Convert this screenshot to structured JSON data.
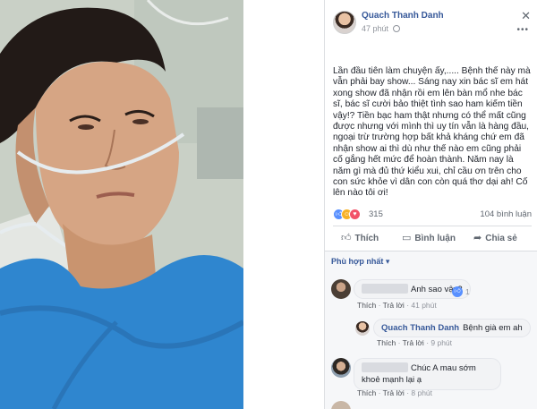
{
  "post": {
    "author": "Quach Thanh Danh",
    "time": "47 phút",
    "text": "Lần đầu tiên làm chuyện ấy,..... Bệnh thế này mà vẫn phải bay show... Sáng nay xin bác sĩ em hát xong show đã nhận rồi em lên bàn mổ nhe bác sĩ, bác sĩ cười bảo thiệt tình sao ham kiếm tiền vậy!? Tiền bạc ham thật nhưng có thể mất cũng được nhưng với mình thì uy tín vẫn là hàng đầu, ngoại trừ trường hợp bất khả kháng chứ em đã nhận show ai thì dù như thế nào em cũng phải cố gắng hết mức để hoàn thành. Năm nay là năm gì mà đủ thứ kiểu xui, chỉ cầu ơn trên cho con sức khỏe vì dân con còn quá thơ dại ah! Cố lên nào tôi ơi!",
    "reaction_count": "315",
    "comment_count": "104 bình luận",
    "close_symbol": "✕",
    "more_symbol": "•••"
  },
  "actions": {
    "like": "Thích",
    "comment": "Bình luận",
    "share": "Chia sẻ"
  },
  "sort_label": "Phù hợp nhất ▾",
  "comments": [
    {
      "text": "Anh sao vậy?",
      "like_label": "Thích",
      "reply_label": "Trả lời",
      "time": "41 phút",
      "likes": "1"
    },
    {
      "name": "Quach Thanh Danh",
      "text": "Bệnh già em ah",
      "like_label": "Thích",
      "reply_label": "Trả lời",
      "time": "9 phút"
    },
    {
      "text": "Chúc A mau sớm khoẻ mạnh lại ạ",
      "like_label": "Thích",
      "reply_label": "Trả lời",
      "time": "8 phút"
    }
  ],
  "colors": {
    "link_blue": "#365899",
    "meta_gray": "#90949c",
    "like_blue": "#5890ff",
    "gown_blue": "#2f86cf"
  },
  "icons": {
    "like": "thumb-up-icon",
    "comment": "speech-bubble-icon",
    "share": "share-arrow-icon",
    "reactions": [
      "like-reaction-icon",
      "haha-reaction-icon",
      "love-reaction-icon"
    ]
  }
}
